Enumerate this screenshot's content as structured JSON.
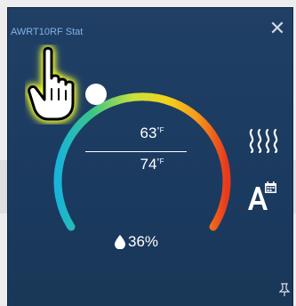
{
  "window": {
    "title": "AWRT10RF Stat",
    "close_glyph": "✕"
  },
  "thermostat": {
    "setpoint_high": "63",
    "setpoint_low": "74",
    "unit": "°F",
    "humidity": "36%"
  },
  "icons": {
    "heat": "heat-waves-icon",
    "mode": "auto-schedule-icon",
    "pin": "pin-icon",
    "drop": "water-drop-icon",
    "hand": "pointer-hand-icon"
  },
  "colors": {
    "panel": "#1c3d62",
    "title": "#7fb3e8",
    "text": "#ffffff",
    "arc_cool": "#18b4d9",
    "arc_mid": "#f3d21b",
    "arc_warm": "#e8391d"
  }
}
